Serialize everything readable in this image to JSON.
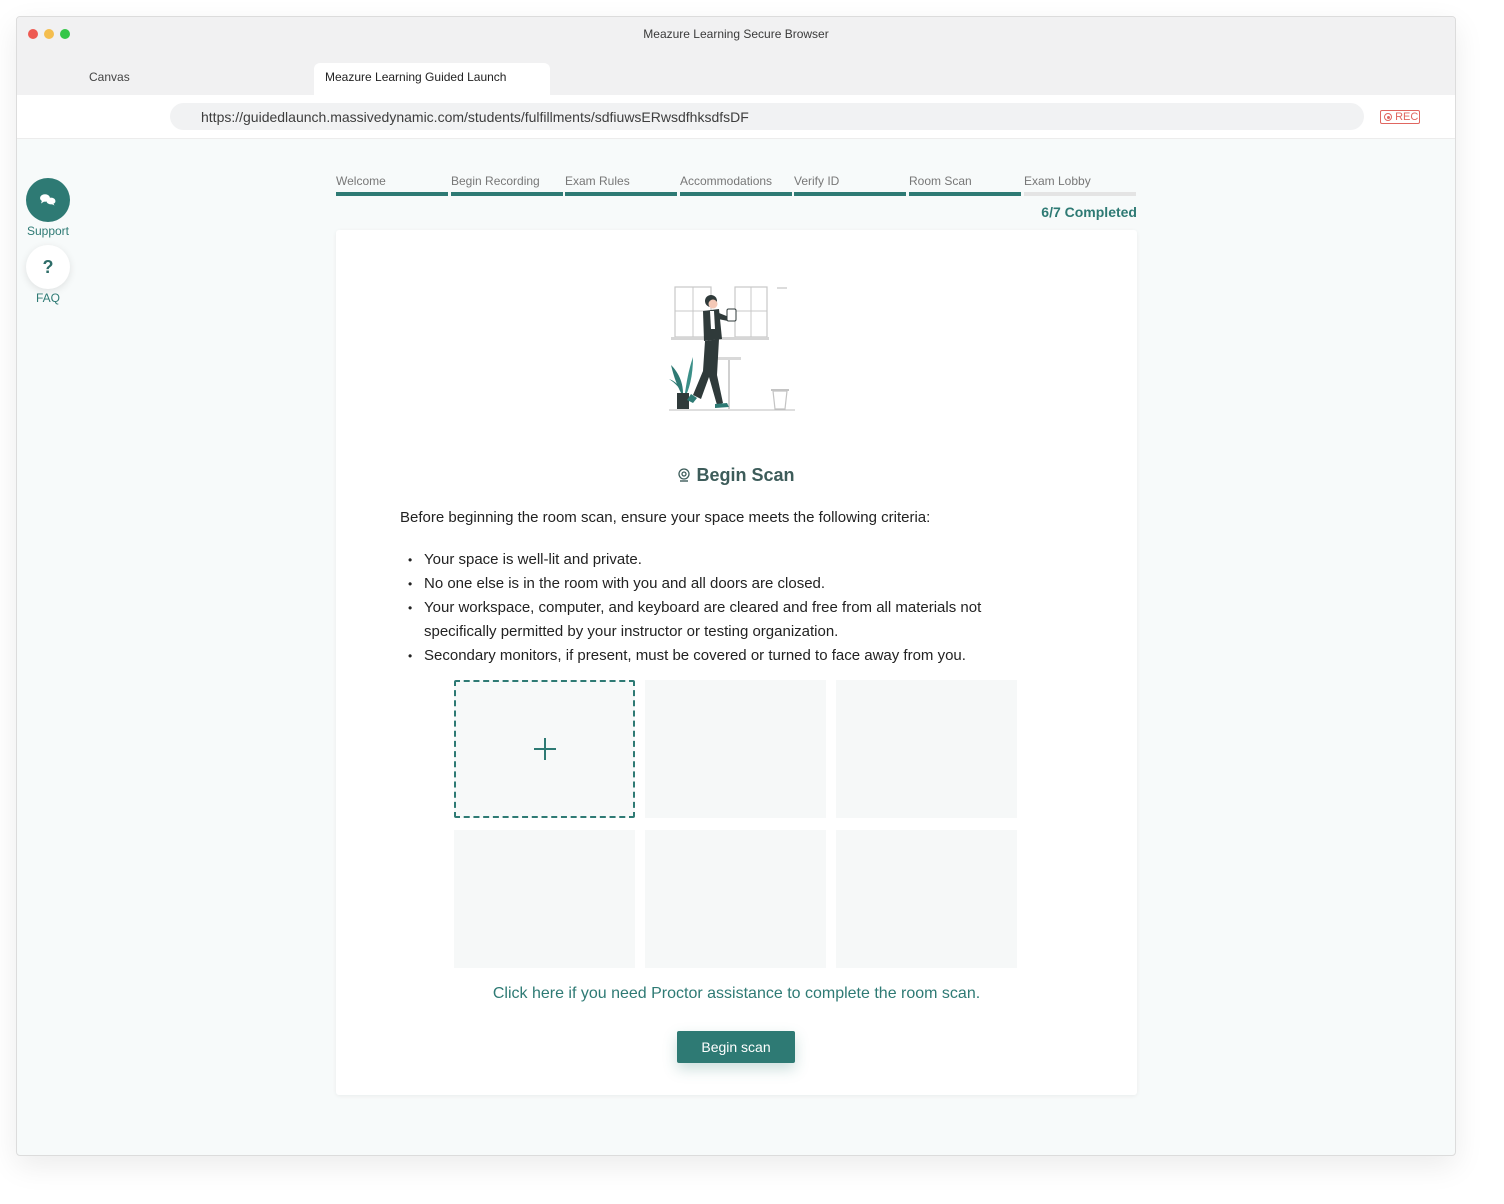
{
  "window": {
    "title": "Meazure Learning Secure Browser"
  },
  "tabs": [
    {
      "label": "Canvas",
      "active": false
    },
    {
      "label": "Meazure Learning Guided Launch",
      "active": true
    }
  ],
  "address_bar": {
    "url": "https://guidedlaunch.massivedynamic.com/students/fulfillments/sdfiuwsERwsdfhksdfsDF",
    "rec_label": "REC"
  },
  "sidebar": {
    "support": {
      "label": "Support",
      "icon": "chat-bubbles-icon"
    },
    "faq": {
      "label": "FAQ",
      "icon_glyph": "?"
    }
  },
  "progress": {
    "steps": [
      {
        "label": "Welcome",
        "done": true
      },
      {
        "label": "Begin Recording",
        "done": true
      },
      {
        "label": "Exam Rules",
        "done": true
      },
      {
        "label": "Accommodations",
        "done": true
      },
      {
        "label": "Verify ID",
        "done": true
      },
      {
        "label": "Room Scan",
        "done": true
      },
      {
        "label": "Exam Lobby",
        "done": false
      }
    ],
    "completed_text": "6/7 Completed"
  },
  "card": {
    "heading": "Begin Scan",
    "intro": "Before beginning the room scan, ensure your space meets the following criteria:",
    "criteria": [
      "Your space is well-lit and private.",
      "No one else is in the room with you and all doors are closed.",
      "Your workspace, computer, and keyboard are cleared and free from all materials not specifically permitted by your instructor or testing organization.",
      "Secondary monitors, if present, must be covered or turned to face away from you."
    ],
    "scan_slots": 6,
    "proctor_link": "Click here if you need Proctor assistance to complete the room scan.",
    "begin_button": "Begin scan"
  },
  "colors": {
    "accent": "#2e7a74",
    "rec": "#e06660",
    "background": "#f7fafa"
  }
}
